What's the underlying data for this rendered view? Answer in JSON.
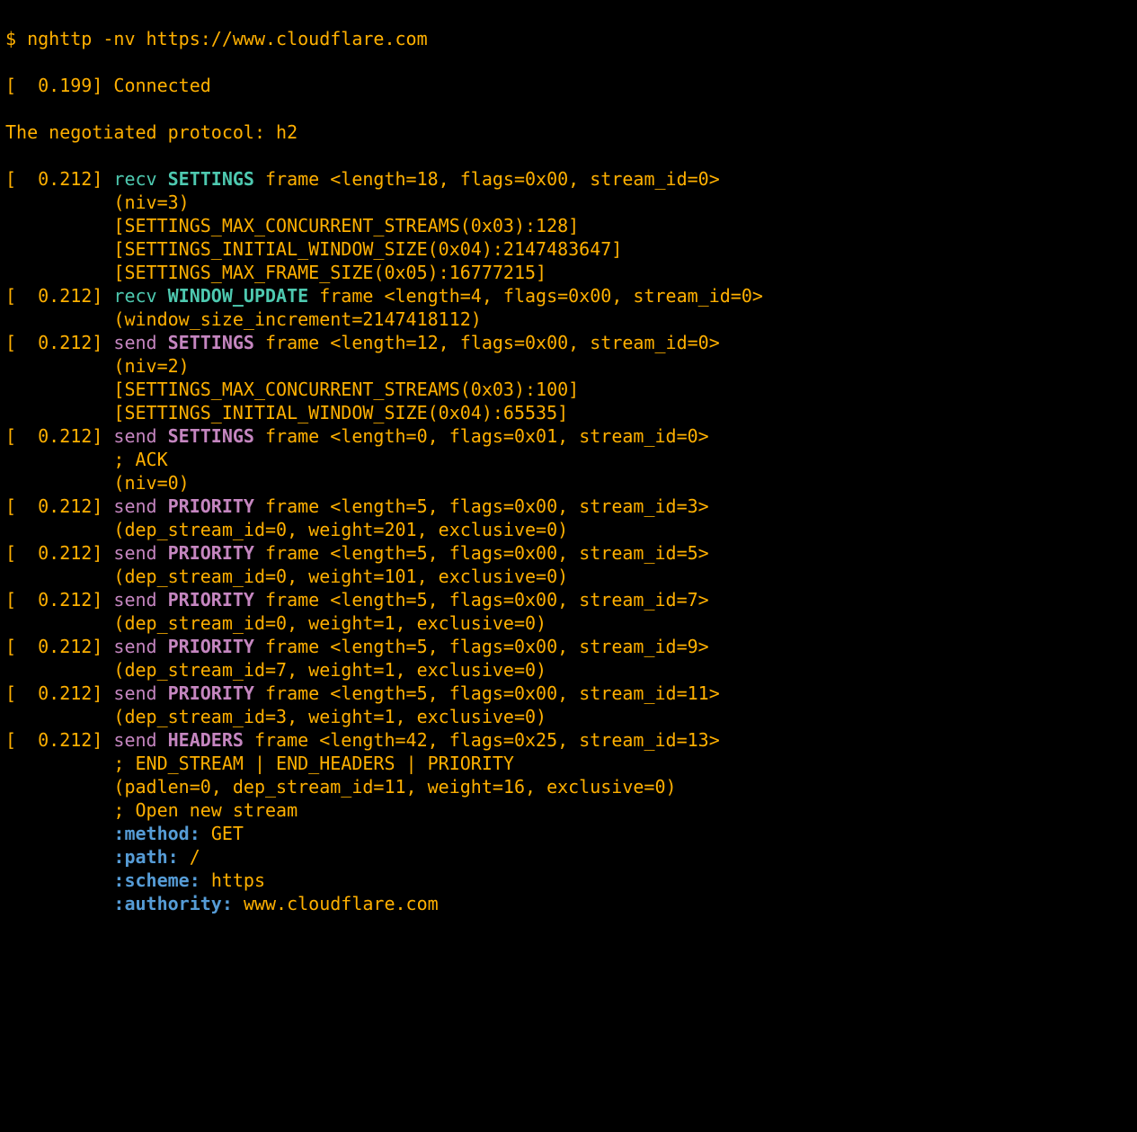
{
  "prompt": "$ ",
  "command": "nghttp -nv https://www.cloudflare.com",
  "connected_ts": "[  0.199]",
  "connected_txt": " Connected",
  "negotiated": "The negotiated protocol: h2",
  "frames": [
    {
      "ts": "[  0.212]",
      "dir": "recv",
      "kw": "SETTINGS",
      "rest": " frame <length=18, flags=0x00, stream_id=0>",
      "extra": [
        "(niv=3)",
        "[SETTINGS_MAX_CONCURRENT_STREAMS(0x03):128]",
        "[SETTINGS_INITIAL_WINDOW_SIZE(0x04):2147483647]",
        "[SETTINGS_MAX_FRAME_SIZE(0x05):16777215]"
      ]
    },
    {
      "ts": "[  0.212]",
      "dir": "recv",
      "kw": "WINDOW_UPDATE",
      "rest": " frame <length=4, flags=0x00, stream_id=0>",
      "extra": [
        "(window_size_increment=2147418112)"
      ]
    },
    {
      "ts": "[  0.212]",
      "dir": "send",
      "kw": "SETTINGS",
      "rest": " frame <length=12, flags=0x00, stream_id=0>",
      "extra": [
        "(niv=2)",
        "[SETTINGS_MAX_CONCURRENT_STREAMS(0x03):100]",
        "[SETTINGS_INITIAL_WINDOW_SIZE(0x04):65535]"
      ]
    },
    {
      "ts": "[  0.212]",
      "dir": "send",
      "kw": "SETTINGS",
      "rest": " frame <length=0, flags=0x01, stream_id=0>",
      "extra": [
        "; ACK",
        "(niv=0)"
      ]
    },
    {
      "ts": "[  0.212]",
      "dir": "send",
      "kw": "PRIORITY",
      "rest": " frame <length=5, flags=0x00, stream_id=3>",
      "extra": [
        "(dep_stream_id=0, weight=201, exclusive=0)"
      ]
    },
    {
      "ts": "[  0.212]",
      "dir": "send",
      "kw": "PRIORITY",
      "rest": " frame <length=5, flags=0x00, stream_id=5>",
      "extra": [
        "(dep_stream_id=0, weight=101, exclusive=0)"
      ]
    },
    {
      "ts": "[  0.212]",
      "dir": "send",
      "kw": "PRIORITY",
      "rest": " frame <length=5, flags=0x00, stream_id=7>",
      "extra": [
        "(dep_stream_id=0, weight=1, exclusive=0)"
      ]
    },
    {
      "ts": "[  0.212]",
      "dir": "send",
      "kw": "PRIORITY",
      "rest": " frame <length=5, flags=0x00, stream_id=9>",
      "extra": [
        "(dep_stream_id=7, weight=1, exclusive=0)"
      ]
    },
    {
      "ts": "[  0.212]",
      "dir": "send",
      "kw": "PRIORITY",
      "rest": " frame <length=5, flags=0x00, stream_id=11>",
      "extra": [
        "(dep_stream_id=3, weight=1, exclusive=0)"
      ]
    },
    {
      "ts": "[  0.212]",
      "dir": "send",
      "kw": "HEADERS",
      "rest": " frame <length=42, flags=0x25, stream_id=13>",
      "extra": [
        "; END_STREAM | END_HEADERS | PRIORITY",
        "(padlen=0, dep_stream_id=11, weight=16, exclusive=0)",
        "; Open new stream"
      ],
      "headers": [
        {
          "name": ":method",
          "value": "GET"
        },
        {
          "name": ":path",
          "value": "/"
        },
        {
          "name": ":scheme",
          "value": "https"
        },
        {
          "name": ":authority",
          "value": "www.cloudflare.com"
        }
      ]
    }
  ]
}
